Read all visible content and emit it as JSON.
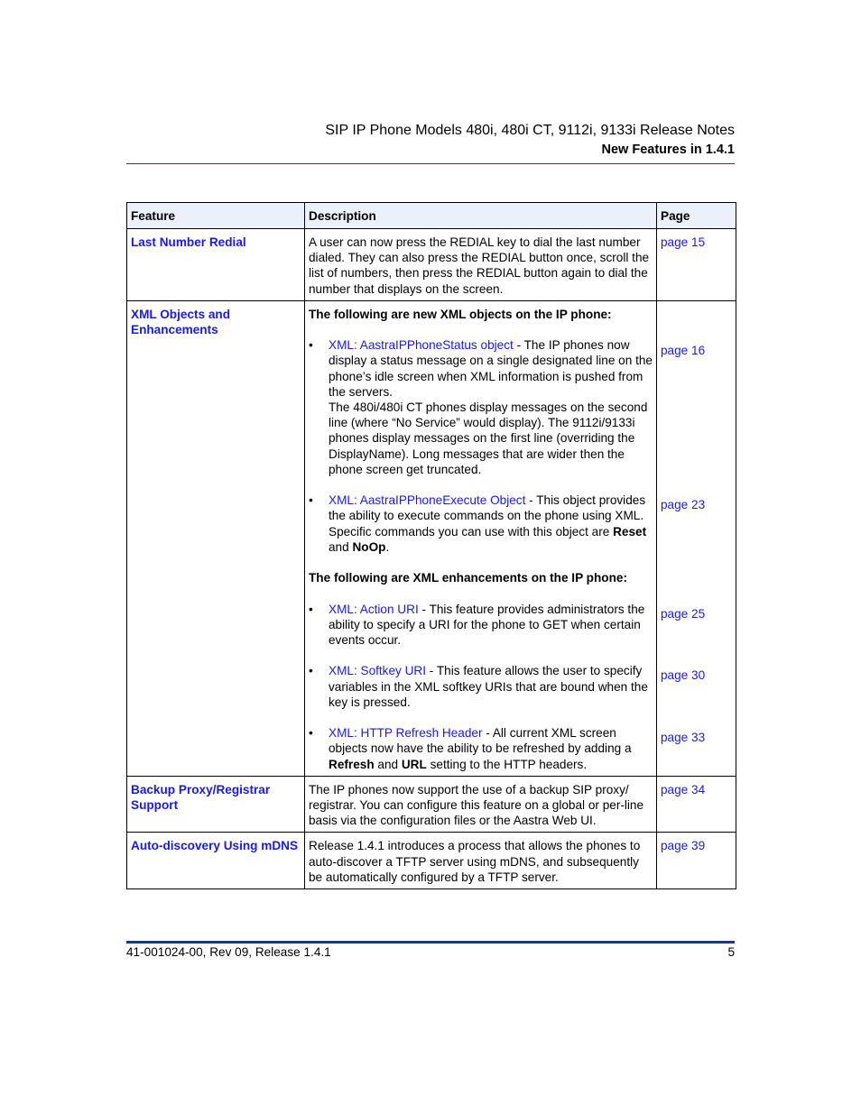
{
  "header": {
    "title": "SIP IP Phone Models 480i, 480i CT, 9112i, 9133i Release Notes",
    "section": "New Features in 1.4.1"
  },
  "table": {
    "columns": [
      "Feature",
      "Description",
      "Page"
    ],
    "rows": {
      "redial": {
        "feature": "Last Number Redial",
        "description": "A user can now press the REDIAL key to dial the last number dialed. They can also press the REDIAL button once, scroll the list of numbers, then press the REDIAL button again to dial the number that displays on the screen.",
        "page": "page 15"
      },
      "xml": {
        "feature": "XML Objects and Enhancements",
        "intro_objects": "The following are new XML objects on the IP phone:",
        "intro_enhancements": "The following are XML enhancements on the IP phone:",
        "bullet_glyph": "•",
        "items": [
          {
            "link": "XML: AastraIPPhoneStatus object",
            "text": " - The IP phones now display a status message on a single designated line on the phone’s idle screen when XML information is pushed from the servers.",
            "extra": "The 480i/480i CT phones display messages on the second line (where “No Service” would display). The 9112i/9133i phones display messages on the first line (overriding the DisplayName). Long messages that are wider then the phone screen get truncated.",
            "page": "page 16"
          },
          {
            "link": "XML: AastraIPPhoneExecute Object",
            "text": " - This object provides the ability to execute commands on the phone using XML. Specific commands you can use with this object are ",
            "bold1": "Reset",
            "mid": " and ",
            "bold2": "NoOp",
            "end": ".",
            "page": "page 23"
          },
          {
            "link": "XML: Action URI",
            "text": " - This feature provides administrators the ability to specify a URI for the phone to GET when certain events occur.",
            "page": "page 25"
          },
          {
            "link": "XML: Softkey URI",
            "text": " - This feature allows the user to specify variables in the XML softkey URIs that are bound when the key is pressed.",
            "page": "page 30"
          },
          {
            "link": "XML: HTTP Refresh Header",
            "text": " - All current XML screen objects now have the ability to be refreshed by adding a ",
            "bold1": "Refresh",
            "mid": " and ",
            "bold2": "URL",
            "end": " setting to the HTTP headers.",
            "page": "page 33"
          }
        ]
      },
      "backup": {
        "feature": "Backup Proxy/Registrar Support",
        "description": "The IP phones now support the use of a backup SIP proxy/ registrar. You can configure this feature on a global or per-line basis via the configuration files or the Aastra Web UI.",
        "page": "page 34"
      },
      "mdns": {
        "feature": "Auto-discovery Using mDNS",
        "description": "Release 1.4.1 introduces a process that allows the phones to auto-discover a TFTP server using mDNS, and subsequently be automatically configured by a TFTP server.",
        "page": "page 39"
      }
    }
  },
  "footer": {
    "doc_id": "41-001024-00, Rev 09, Release 1.4.1",
    "page_number": "5"
  }
}
